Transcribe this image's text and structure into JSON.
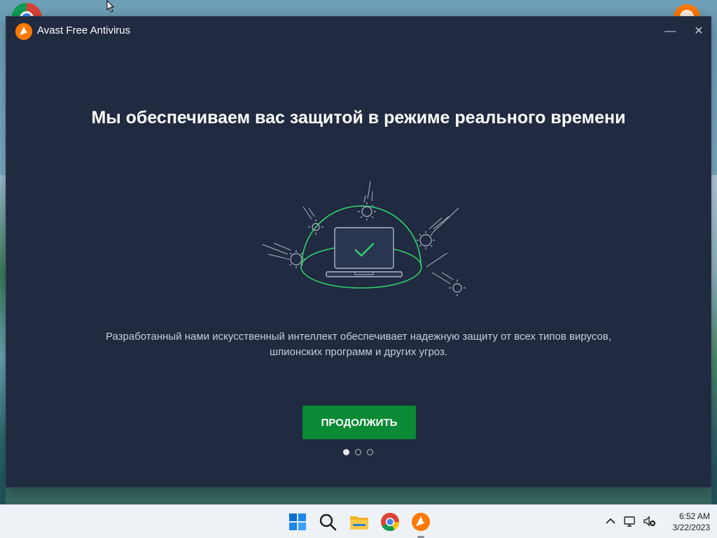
{
  "window": {
    "title": "Avast Free Antivirus",
    "minimize_label": "—",
    "close_label": "✕"
  },
  "onboarding": {
    "headline": "Мы обеспечиваем вас защитой в режиме реального времени",
    "description_line1": "Разработанный нами искусственный интеллект обеспечивает надежную защиту от всех типов вирусов,",
    "description_line2": "шпионских программ и других угроз.",
    "continue_label": "ПРОДОЛЖИТЬ",
    "pager": {
      "total": 3,
      "current": 1
    }
  },
  "taskbar": {
    "icons": [
      "windows-start-icon",
      "search-icon",
      "file-explorer-icon",
      "chrome-icon",
      "avast-icon"
    ],
    "clock_time": "6:52 AM",
    "clock_date": "3/22/2023"
  },
  "colors": {
    "window_bg": "#202a40",
    "accent_green": "#0a8a34",
    "dome_green": "#2fd06a",
    "brand_orange": "#ff7800"
  }
}
